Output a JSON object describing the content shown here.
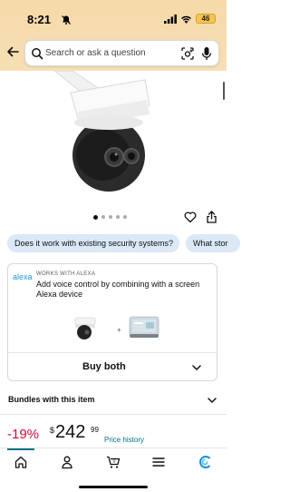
{
  "status_bar": {
    "time": "8:21",
    "battery": "46"
  },
  "search": {
    "placeholder": "Search or ask a question"
  },
  "gallery": {
    "total_images": 5,
    "active_image": 1
  },
  "chips": [
    "Does it work with existing security systems?",
    "What stor"
  ],
  "alexa": {
    "logo": "alexa",
    "tag": "WORKS WITH ALEXA",
    "description": "Add voice control by combining with a screen Alexa device",
    "bundle_separator": "+",
    "buy_both": "Buy both"
  },
  "bundles": {
    "label": "Bundles with this item"
  },
  "price": {
    "discount": "-19%",
    "currency": "$",
    "whole": "242",
    "fraction": "99",
    "history_link": "Price history"
  },
  "colors": {
    "accent": "#007185",
    "discount": "#cc0c39",
    "chip": "#dbe8f7",
    "header": "#f5d9a8"
  },
  "tab_bar": {
    "items": [
      "home-icon",
      "account-icon",
      "cart-icon",
      "menu-icon",
      "rufus-icon"
    ],
    "active": 0
  }
}
